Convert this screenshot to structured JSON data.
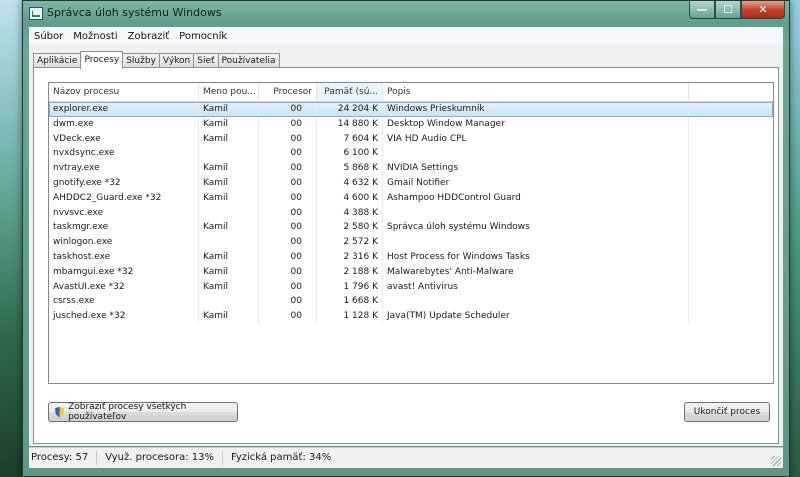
{
  "window": {
    "title": "Správca úloh systému Windows",
    "min_label": "—",
    "max_label": "☐",
    "close_label": "✕"
  },
  "menu": [
    "Súbor",
    "Možnosti",
    "Zobraziť",
    "Pomocník"
  ],
  "tabs": [
    "Aplikácie",
    "Procesy",
    "Služby",
    "Výkon",
    "Sieť",
    "Používatelia"
  ],
  "active_tab": "Procesy",
  "columns": {
    "name": "Názov procesu",
    "user": "Meno pou...",
    "cpu": "Procesor",
    "mem": "Pamäť (sú...",
    "desc": "Popis"
  },
  "processes": [
    {
      "name": "explorer.exe",
      "user": "Kamil",
      "cpu": "00",
      "mem": "24 204 K",
      "desc": "Windows Prieskumník"
    },
    {
      "name": "dwm.exe",
      "user": "Kamil",
      "cpu": "00",
      "mem": "14 880 K",
      "desc": "Desktop Window Manager"
    },
    {
      "name": "VDeck.exe",
      "user": "Kamil",
      "cpu": "00",
      "mem": "7 604 K",
      "desc": "VIA HD Audio CPL"
    },
    {
      "name": "nvxdsync.exe",
      "user": "",
      "cpu": "00",
      "mem": "6 100 K",
      "desc": ""
    },
    {
      "name": "nvtray.exe",
      "user": "Kamil",
      "cpu": "00",
      "mem": "5 868 K",
      "desc": "NVIDIA Settings"
    },
    {
      "name": "gnotify.exe *32",
      "user": "Kamil",
      "cpu": "00",
      "mem": "4 632 K",
      "desc": "Gmail Notifier"
    },
    {
      "name": "AHDDC2_Guard.exe *32",
      "user": "Kamil",
      "cpu": "00",
      "mem": "4 600 K",
      "desc": "Ashampoo HDDControl Guard"
    },
    {
      "name": "nvvsvc.exe",
      "user": "",
      "cpu": "00",
      "mem": "4 388 K",
      "desc": ""
    },
    {
      "name": "taskmgr.exe",
      "user": "Kamil",
      "cpu": "00",
      "mem": "2 580 K",
      "desc": "Správca úloh systému Windows"
    },
    {
      "name": "winlogon.exe",
      "user": "",
      "cpu": "00",
      "mem": "2 572 K",
      "desc": ""
    },
    {
      "name": "taskhost.exe",
      "user": "Kamil",
      "cpu": "00",
      "mem": "2 316 K",
      "desc": "Host Process for Windows Tasks"
    },
    {
      "name": "mbamgui.exe *32",
      "user": "Kamil",
      "cpu": "00",
      "mem": "2 188 K",
      "desc": "Malwarebytes' Anti-Malware"
    },
    {
      "name": "AvastUI.exe *32",
      "user": "Kamil",
      "cpu": "00",
      "mem": "1 796 K",
      "desc": "avast! Antivirus"
    },
    {
      "name": "csrss.exe",
      "user": "",
      "cpu": "00",
      "mem": "1 668 K",
      "desc": ""
    },
    {
      "name": "jusched.exe *32",
      "user": "Kamil",
      "cpu": "00",
      "mem": "1 128 K",
      "desc": "Java(TM) Update Scheduler"
    }
  ],
  "selected_row": 0,
  "buttons": {
    "show_all": "Zobraziť procesy všetkých používateľov",
    "end_process": "Ukončiť proces"
  },
  "status": {
    "processes": "Procesy: 57",
    "cpu_usage": "Využ. procesora: 13%",
    "physical_memory": "Fyzická pamäť: 34%"
  }
}
